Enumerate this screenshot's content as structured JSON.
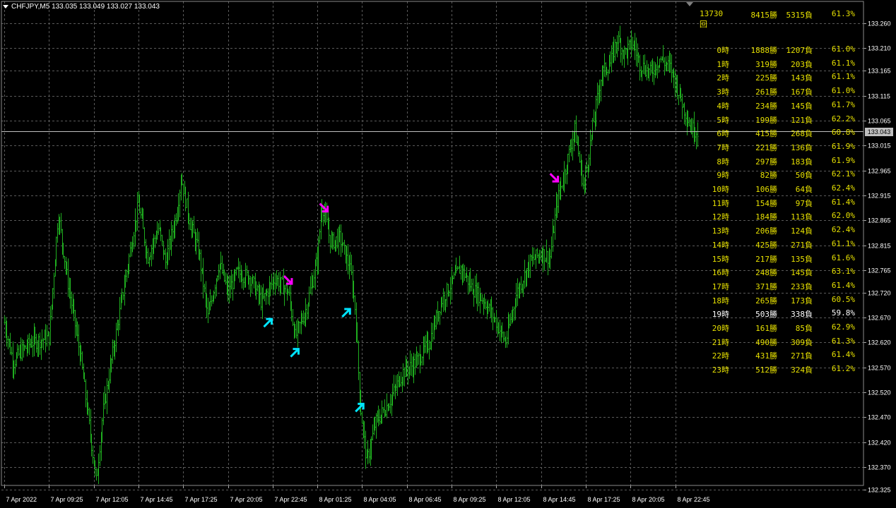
{
  "header": {
    "symbol": "CHFJPY,M5",
    "ohlc": "133.035 133.049 133.027 133.043"
  },
  "current_price": "133.043",
  "summary": {
    "total": "13730回",
    "wins": "8415勝",
    "losses": "5315負",
    "rate": "61.3%"
  },
  "hourly_stats": [
    {
      "hour": "0時",
      "wins": "1888勝",
      "losses": "1207負",
      "rate": "61.0%"
    },
    {
      "hour": "1時",
      "wins": "319勝",
      "losses": "203負",
      "rate": "61.1%"
    },
    {
      "hour": "2時",
      "wins": "225勝",
      "losses": "143負",
      "rate": "61.1%"
    },
    {
      "hour": "3時",
      "wins": "261勝",
      "losses": "167負",
      "rate": "61.0%"
    },
    {
      "hour": "4時",
      "wins": "234勝",
      "losses": "145負",
      "rate": "61.7%"
    },
    {
      "hour": "5時",
      "wins": "199勝",
      "losses": "121負",
      "rate": "62.2%"
    },
    {
      "hour": "6時",
      "wins": "415勝",
      "losses": "268負",
      "rate": "60.8%"
    },
    {
      "hour": "7時",
      "wins": "221勝",
      "losses": "136負",
      "rate": "61.9%"
    },
    {
      "hour": "8時",
      "wins": "297勝",
      "losses": "183負",
      "rate": "61.9%"
    },
    {
      "hour": "9時",
      "wins": "82勝",
      "losses": "50負",
      "rate": "62.1%"
    },
    {
      "hour": "10時",
      "wins": "106勝",
      "losses": "64負",
      "rate": "62.4%"
    },
    {
      "hour": "11時",
      "wins": "154勝",
      "losses": "97負",
      "rate": "61.4%"
    },
    {
      "hour": "12時",
      "wins": "184勝",
      "losses": "113負",
      "rate": "62.0%"
    },
    {
      "hour": "13時",
      "wins": "206勝",
      "losses": "124負",
      "rate": "62.4%"
    },
    {
      "hour": "14時",
      "wins": "425勝",
      "losses": "271負",
      "rate": "61.1%"
    },
    {
      "hour": "15時",
      "wins": "217勝",
      "losses": "135負",
      "rate": "61.6%"
    },
    {
      "hour": "16時",
      "wins": "248勝",
      "losses": "145負",
      "rate": "63.1%"
    },
    {
      "hour": "17時",
      "wins": "371勝",
      "losses": "233負",
      "rate": "61.4%"
    },
    {
      "hour": "18時",
      "wins": "265勝",
      "losses": "173負",
      "rate": "60.5%"
    },
    {
      "hour": "19時",
      "wins": "503勝",
      "losses": "338負",
      "rate": "59.8%"
    },
    {
      "hour": "20時",
      "wins": "161勝",
      "losses": "85負",
      "rate": "62.9%"
    },
    {
      "hour": "21時",
      "wins": "490勝",
      "losses": "309負",
      "rate": "61.3%"
    },
    {
      "hour": "22時",
      "wins": "431勝",
      "losses": "271負",
      "rate": "61.4%"
    },
    {
      "hour": "23時",
      "wins": "512勝",
      "losses": "324負",
      "rate": "61.2%"
    }
  ],
  "colors": {
    "background": "#000000",
    "grid": "#5a5a5a",
    "bars": "#1fae1f",
    "stats_text": "#e6e000",
    "highlight_row": "#ffffff",
    "buy_arrow": "#00e5ff",
    "sell_arrow": "#ff00ff",
    "price_line": "#c0c0c0"
  },
  "chart_data": {
    "type": "bar",
    "subtype": "OHLC price bars",
    "symbol": "CHFJPY",
    "timeframe": "M5",
    "ylim": [
      132.325,
      133.26
    ],
    "y_ticks": [
      "133.260",
      "133.210",
      "133.165",
      "133.115",
      "133.065",
      "133.015",
      "132.965",
      "132.915",
      "132.865",
      "132.815",
      "132.765",
      "132.720",
      "132.670",
      "132.620",
      "132.570",
      "132.520",
      "132.470",
      "132.420",
      "132.370",
      "132.325"
    ],
    "x_ticks": [
      "7 Apr 2022",
      "7 Apr 09:25",
      "7 Apr 12:05",
      "7 Apr 14:45",
      "7 Apr 17:25",
      "7 Apr 20:05",
      "7 Apr 22:45",
      "8 Apr 01:25",
      "8 Apr 04:05",
      "8 Apr 06:45",
      "8 Apr 09:25",
      "8 Apr 12:05",
      "8 Apr 14:45",
      "8 Apr 17:25",
      "8 Apr 20:05",
      "8 Apr 22:45"
    ],
    "grid": true,
    "close_path": [
      [
        0,
        132.66
      ],
      [
        0.2,
        132.58
      ],
      [
        0.35,
        132.6
      ],
      [
        0.6,
        132.62
      ],
      [
        1.0,
        132.63
      ],
      [
        1.2,
        132.88
      ],
      [
        1.4,
        132.75
      ],
      [
        1.7,
        132.59
      ],
      [
        1.9,
        132.45
      ],
      [
        2.05,
        132.34
      ],
      [
        2.2,
        132.48
      ],
      [
        2.5,
        132.64
      ],
      [
        2.9,
        132.85
      ],
      [
        3.0,
        132.9
      ],
      [
        3.2,
        132.79
      ],
      [
        3.45,
        132.85
      ],
      [
        3.6,
        132.78
      ],
      [
        3.85,
        132.88
      ],
      [
        3.95,
        132.95
      ],
      [
        4.15,
        132.86
      ],
      [
        4.35,
        132.8
      ],
      [
        4.55,
        132.67
      ],
      [
        4.8,
        132.78
      ],
      [
        5.0,
        132.72
      ],
      [
        5.2,
        132.76
      ],
      [
        5.5,
        132.75
      ],
      [
        5.75,
        132.7
      ],
      [
        6.05,
        132.75
      ],
      [
        6.35,
        132.72
      ],
      [
        6.5,
        132.63
      ],
      [
        6.75,
        132.69
      ],
      [
        7.0,
        132.79
      ],
      [
        7.1,
        132.9
      ],
      [
        7.3,
        132.82
      ],
      [
        7.5,
        132.83
      ],
      [
        7.75,
        132.76
      ],
      [
        7.85,
        132.68
      ],
      [
        7.95,
        132.5
      ],
      [
        8.1,
        132.38
      ],
      [
        8.3,
        132.46
      ],
      [
        8.6,
        132.5
      ],
      [
        8.9,
        132.56
      ],
      [
        9.2,
        132.58
      ],
      [
        9.5,
        132.62
      ],
      [
        9.75,
        132.7
      ],
      [
        10.0,
        132.74
      ],
      [
        10.2,
        132.77
      ],
      [
        10.45,
        132.73
      ],
      [
        10.75,
        132.7
      ],
      [
        11.0,
        132.66
      ],
      [
        11.2,
        132.62
      ],
      [
        11.45,
        132.72
      ],
      [
        11.75,
        132.78
      ],
      [
        12.0,
        132.8
      ],
      [
        12.2,
        132.79
      ],
      [
        12.35,
        132.9
      ],
      [
        12.55,
        132.97
      ],
      [
        12.75,
        133.05
      ],
      [
        12.95,
        132.93
      ],
      [
        13.15,
        133.05
      ],
      [
        13.35,
        133.16
      ],
      [
        13.55,
        133.18
      ],
      [
        13.7,
        133.23
      ],
      [
        13.85,
        133.2
      ],
      [
        14.05,
        133.22
      ],
      [
        14.2,
        133.18
      ],
      [
        14.45,
        133.16
      ],
      [
        14.65,
        133.19
      ],
      [
        14.9,
        133.17
      ],
      [
        15.15,
        133.1
      ],
      [
        15.35,
        133.05
      ],
      [
        15.5,
        133.043
      ]
    ],
    "signals": [
      {
        "type": "buy",
        "time": 5.9,
        "price": 132.66
      },
      {
        "type": "sell",
        "time": 6.35,
        "price": 132.745
      },
      {
        "type": "buy",
        "time": 6.5,
        "price": 132.6
      },
      {
        "type": "sell",
        "time": 7.15,
        "price": 132.89
      },
      {
        "type": "buy",
        "time": 7.65,
        "price": 132.68
      },
      {
        "type": "buy",
        "time": 7.95,
        "price": 132.49
      },
      {
        "type": "sell",
        "time": 12.3,
        "price": 132.95
      }
    ]
  }
}
